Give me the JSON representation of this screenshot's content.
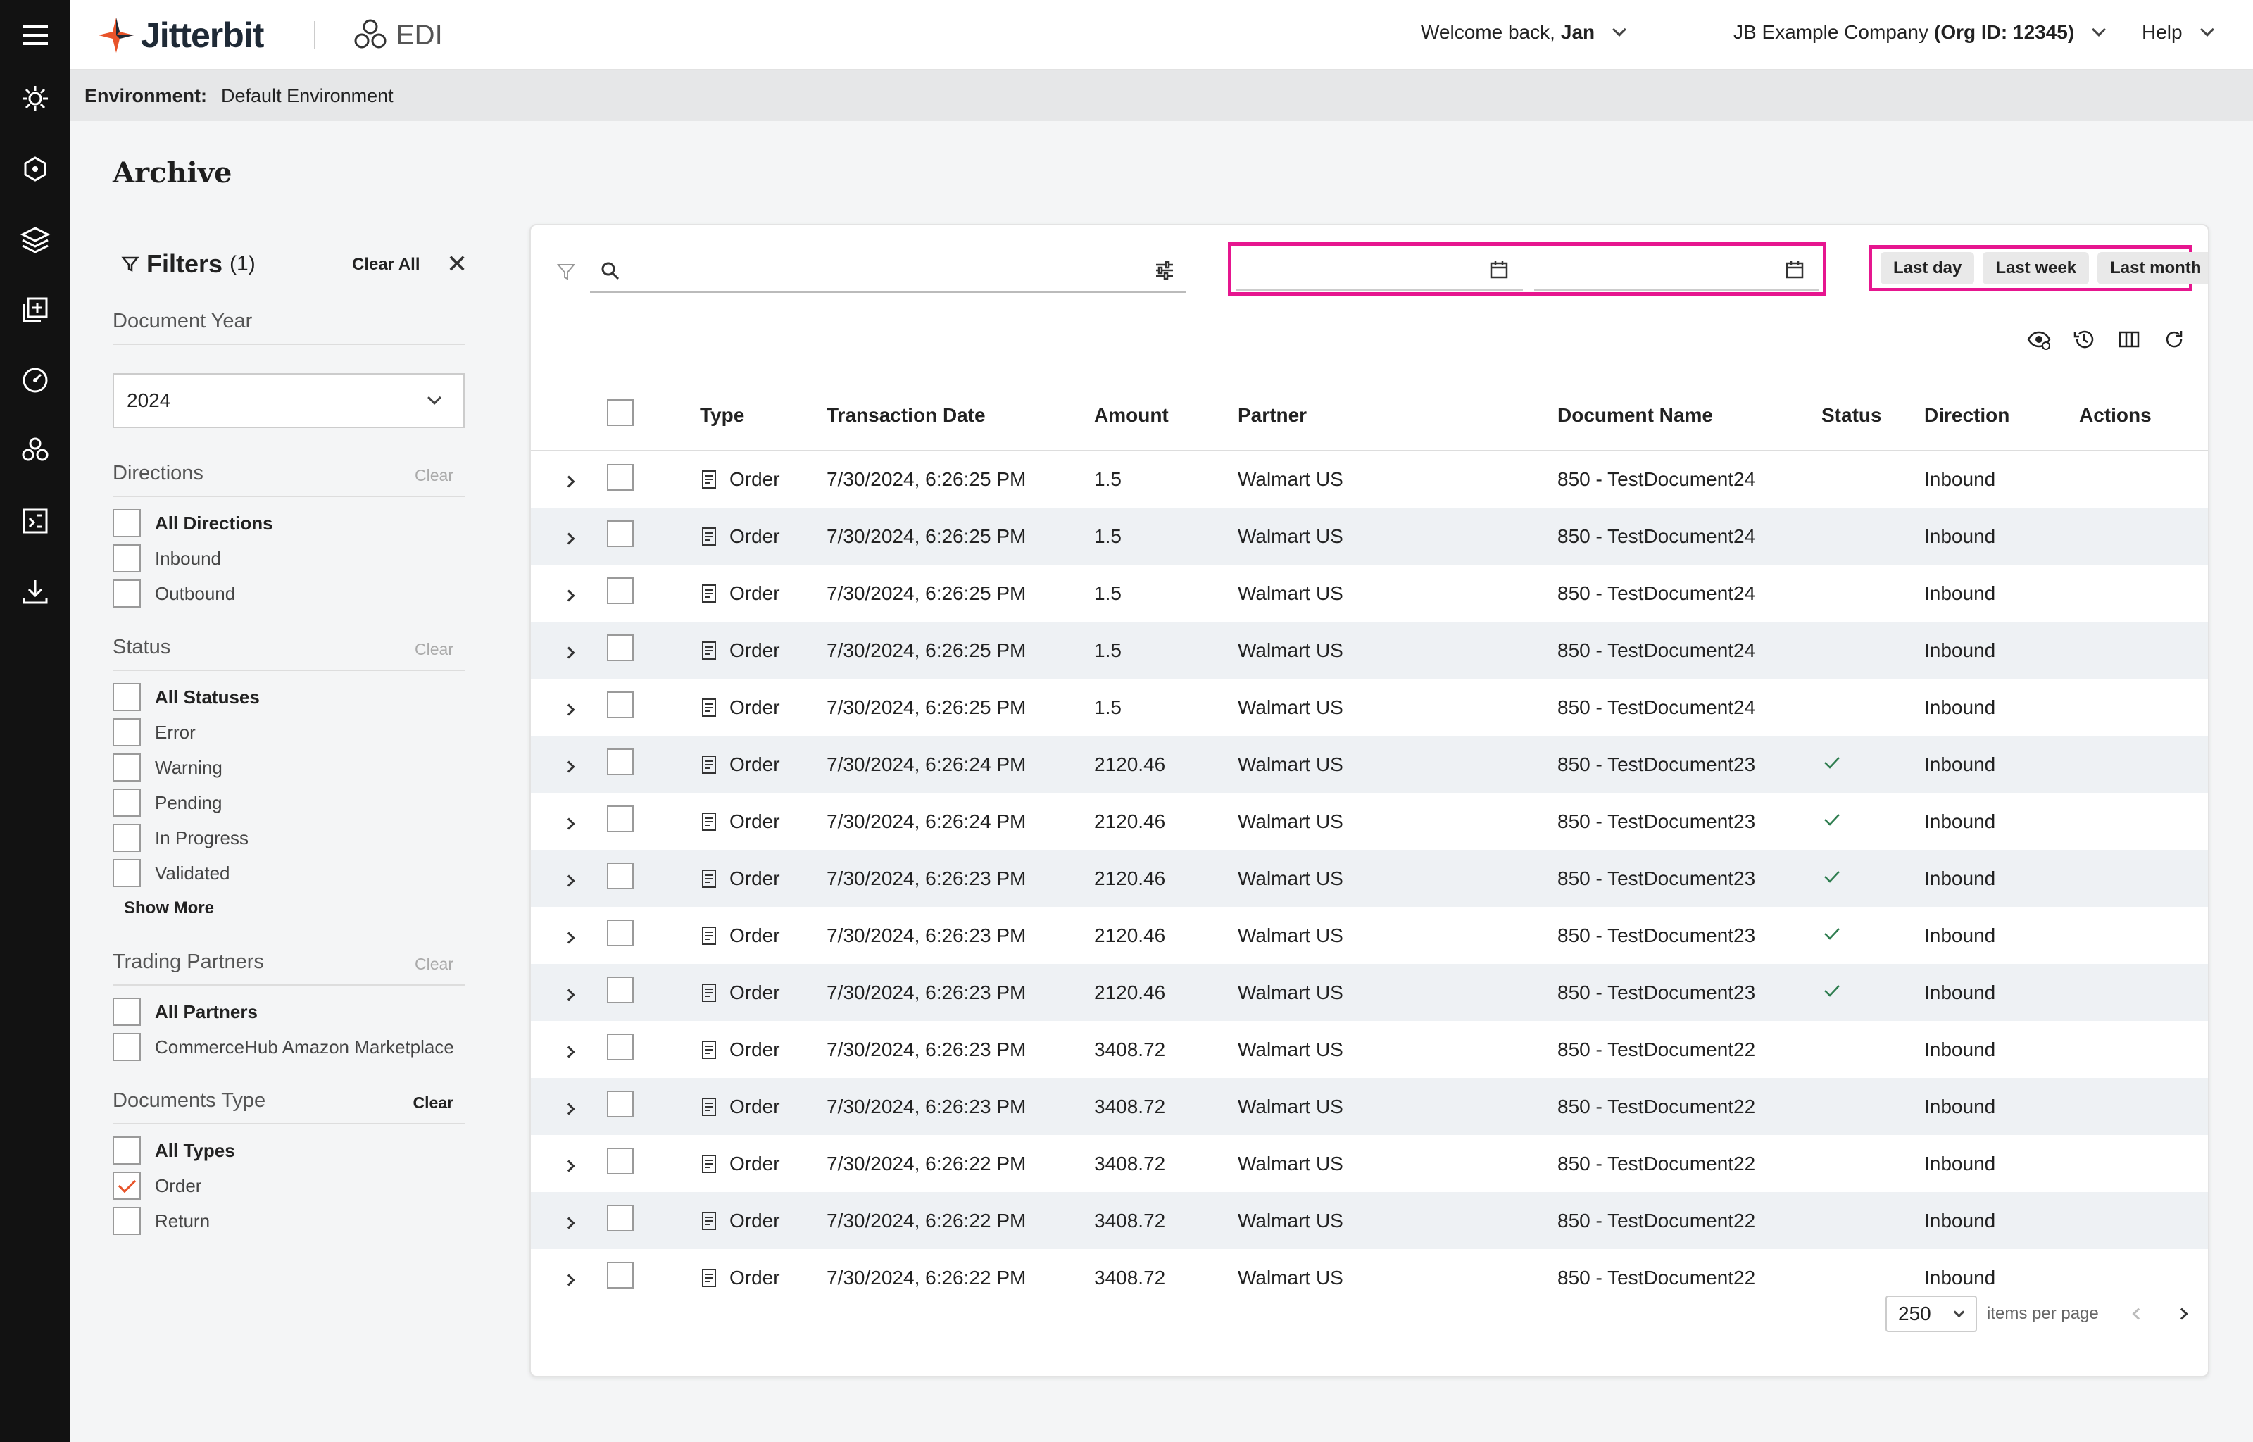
{
  "app": {
    "brand": "Jitterbit",
    "product": "EDI"
  },
  "header": {
    "welcome_prefix": "Welcome back,",
    "user": "Jan",
    "company": "JB Example Company",
    "org": "(Org ID: 12345)",
    "help": "Help"
  },
  "environment": {
    "label": "Environment:",
    "value": "Default Environment"
  },
  "page": {
    "title": "Archive"
  },
  "filters": {
    "title": "Filters",
    "count": "(1)",
    "clear_all": "Clear All",
    "document_year": {
      "label": "Document Year",
      "value": "2024"
    },
    "directions": {
      "label": "Directions",
      "clear": "Clear",
      "options": [
        "All Directions",
        "Inbound",
        "Outbound"
      ]
    },
    "status": {
      "label": "Status",
      "clear": "Clear",
      "options": [
        "All Statuses",
        "Error",
        "Warning",
        "Pending",
        "In Progress",
        "Validated"
      ],
      "show_more": "Show More"
    },
    "partners": {
      "label": "Trading Partners",
      "clear": "Clear",
      "options": [
        "All Partners",
        "CommerceHub Amazon Marketplace"
      ]
    },
    "doc_types": {
      "label": "Documents Type",
      "clear": "Clear",
      "options": [
        "All Types",
        "Order",
        "Return"
      ],
      "checked": "Order"
    }
  },
  "toolbar": {
    "search_placeholder": "",
    "start_date_placeholder": "",
    "end_date_placeholder": "",
    "quick_ranges": [
      "Last day",
      "Last week",
      "Last month"
    ],
    "icons": [
      "visibility-settings-icon",
      "history-icon",
      "columns-icon",
      "refresh-icon"
    ]
  },
  "table": {
    "columns": [
      "Type",
      "Transaction Date",
      "Amount",
      "Partner",
      "Document Name",
      "Status",
      "Direction",
      "Actions"
    ],
    "rows": [
      {
        "type": "Order",
        "date": "7/30/2024, 6:26:25 PM",
        "amount": "1.5",
        "partner": "Walmart US",
        "doc": "850 - TestDocument24",
        "validated": false,
        "direction": "Inbound"
      },
      {
        "type": "Order",
        "date": "7/30/2024, 6:26:25 PM",
        "amount": "1.5",
        "partner": "Walmart US",
        "doc": "850 - TestDocument24",
        "validated": false,
        "direction": "Inbound"
      },
      {
        "type": "Order",
        "date": "7/30/2024, 6:26:25 PM",
        "amount": "1.5",
        "partner": "Walmart US",
        "doc": "850 - TestDocument24",
        "validated": false,
        "direction": "Inbound"
      },
      {
        "type": "Order",
        "date": "7/30/2024, 6:26:25 PM",
        "amount": "1.5",
        "partner": "Walmart US",
        "doc": "850 - TestDocument24",
        "validated": false,
        "direction": "Inbound"
      },
      {
        "type": "Order",
        "date": "7/30/2024, 6:26:25 PM",
        "amount": "1.5",
        "partner": "Walmart US",
        "doc": "850 - TestDocument24",
        "validated": false,
        "direction": "Inbound"
      },
      {
        "type": "Order",
        "date": "7/30/2024, 6:26:24 PM",
        "amount": "2120.46",
        "partner": "Walmart US",
        "doc": "850 - TestDocument23",
        "validated": true,
        "direction": "Inbound"
      },
      {
        "type": "Order",
        "date": "7/30/2024, 6:26:24 PM",
        "amount": "2120.46",
        "partner": "Walmart US",
        "doc": "850 - TestDocument23",
        "validated": true,
        "direction": "Inbound"
      },
      {
        "type": "Order",
        "date": "7/30/2024, 6:26:23 PM",
        "amount": "2120.46",
        "partner": "Walmart US",
        "doc": "850 - TestDocument23",
        "validated": true,
        "direction": "Inbound"
      },
      {
        "type": "Order",
        "date": "7/30/2024, 6:26:23 PM",
        "amount": "2120.46",
        "partner": "Walmart US",
        "doc": "850 - TestDocument23",
        "validated": true,
        "direction": "Inbound"
      },
      {
        "type": "Order",
        "date": "7/30/2024, 6:26:23 PM",
        "amount": "2120.46",
        "partner": "Walmart US",
        "doc": "850 - TestDocument23",
        "validated": true,
        "direction": "Inbound"
      },
      {
        "type": "Order",
        "date": "7/30/2024, 6:26:23 PM",
        "amount": "3408.72",
        "partner": "Walmart US",
        "doc": "850 - TestDocument22",
        "validated": false,
        "direction": "Inbound"
      },
      {
        "type": "Order",
        "date": "7/30/2024, 6:26:23 PM",
        "amount": "3408.72",
        "partner": "Walmart US",
        "doc": "850 - TestDocument22",
        "validated": false,
        "direction": "Inbound"
      },
      {
        "type": "Order",
        "date": "7/30/2024, 6:26:22 PM",
        "amount": "3408.72",
        "partner": "Walmart US",
        "doc": "850 - TestDocument22",
        "validated": false,
        "direction": "Inbound"
      },
      {
        "type": "Order",
        "date": "7/30/2024, 6:26:22 PM",
        "amount": "3408.72",
        "partner": "Walmart US",
        "doc": "850 - TestDocument22",
        "validated": false,
        "direction": "Inbound"
      },
      {
        "type": "Order",
        "date": "7/30/2024, 6:26:22 PM",
        "amount": "3408.72",
        "partner": "Walmart US",
        "doc": "850 - TestDocument22",
        "validated": false,
        "direction": "Inbound"
      }
    ]
  },
  "pagination": {
    "per_page": "250",
    "per_page_label": "items per page"
  },
  "colors": {
    "accent": "#e8542a",
    "highlight": "#e6168f",
    "rail": "#121212",
    "status_ok": "#2e7d4f"
  }
}
